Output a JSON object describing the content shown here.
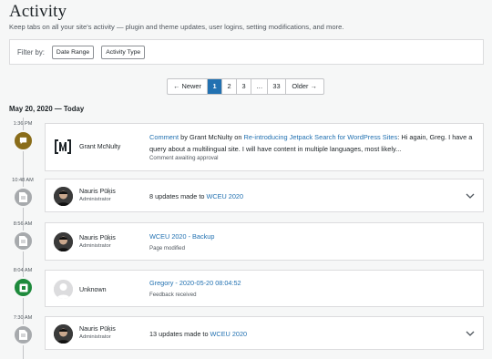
{
  "page": {
    "title": "Activity",
    "subtitle": "Keep tabs on all your site's activity — plugin and theme updates, user logins, setting modifications, and more."
  },
  "filter": {
    "label": "Filter by:",
    "date_range": "Date Range",
    "activity_type": "Activity Type"
  },
  "pagination": {
    "newer": "Newer",
    "pages": [
      "1",
      "2",
      "3",
      "…",
      "33"
    ],
    "current": "1",
    "older": "Older"
  },
  "date_header": "May 20, 2020 — Today",
  "events": [
    {
      "time": "1:36 PM",
      "marker_color": "#8a6d1a",
      "marker_icon": "comment-icon",
      "actor": "Grant McNulty",
      "role": "",
      "desc_pre": "Comment",
      "desc_mid": " by Grant McNulty on ",
      "desc_link": "Re-introducing Jetpack Search for WordPress Sites",
      "desc_post": ": Hi again, Greg. I have a query about a multilingual site. I will have content in multiple languages, most likely...",
      "meta": "Comment awaiting approval"
    },
    {
      "time": "10:48 AM",
      "marker_color": "#a7aaad",
      "marker_icon": "page-icon",
      "actor": "Nauris Pūķis",
      "role": "Administrator",
      "desc_pre": "8 updates made to ",
      "desc_link": "WCEU 2020",
      "meta": ""
    },
    {
      "time": "8:56 AM",
      "marker_color": "#a7aaad",
      "marker_icon": "page-icon",
      "actor": "Nauris Pūķis",
      "role": "Administrator",
      "desc_link": "WCEU 2020 - Backup",
      "meta": "Page modified"
    },
    {
      "time": "8:04 AM",
      "marker_color": "#1e8a3c",
      "marker_icon": "feedback-icon",
      "actor": "Unknown",
      "role": "",
      "desc_link": "Gregory - 2020-05-20 08:04:52",
      "meta": "Feedback received"
    },
    {
      "time": "7:30 AM",
      "marker_color": "#a7aaad",
      "marker_icon": "page-icon",
      "actor": "Nauris Pūķis",
      "role": "Administrator",
      "desc_pre": "13 updates made to ",
      "desc_link": "WCEU 2020",
      "meta": ""
    }
  ]
}
